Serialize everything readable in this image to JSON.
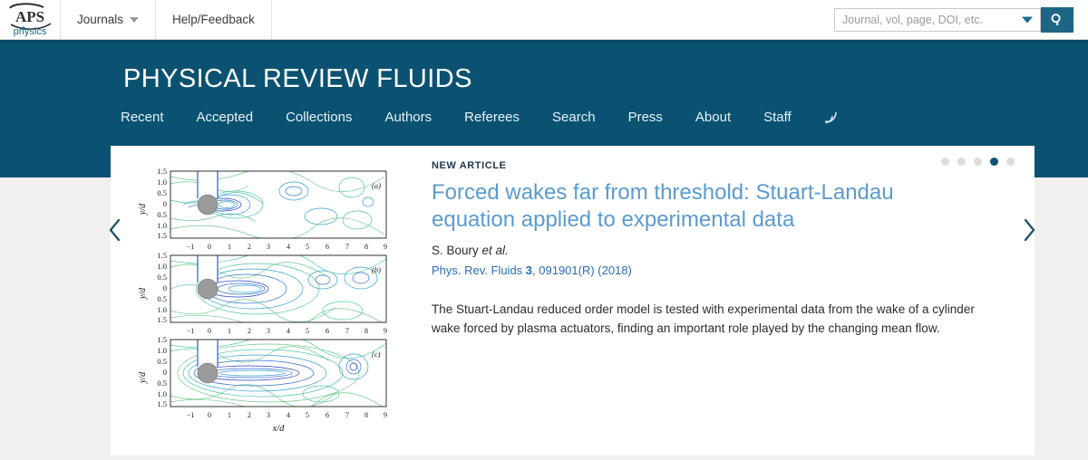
{
  "topbar": {
    "logo": {
      "primary": "APS",
      "secondary": "physics",
      "name": "aps-physics-logo"
    },
    "nav": [
      {
        "label": "Journals",
        "has_dropdown": true
      },
      {
        "label": "Help/Feedback",
        "has_dropdown": false
      }
    ],
    "search": {
      "placeholder": "Journal, vol, page, DOI, etc.",
      "value": "",
      "button_icon": "search-icon",
      "dropdown_icon": "chevron-down-icon"
    }
  },
  "banner": {
    "title": "PHYSICAL REVIEW FLUIDS",
    "background": "#0b5272",
    "nav": [
      "Recent",
      "Accepted",
      "Collections",
      "Authors",
      "Referees",
      "Search",
      "Press",
      "About",
      "Staff"
    ],
    "rss_icon": "rss-feed-icon"
  },
  "carousel": {
    "dots_total": 5,
    "active_index": 3,
    "prev_icon": "chevron-left-icon",
    "next_icon": "chevron-right-icon",
    "accent_color": "#0b5272"
  },
  "article": {
    "kicker": "NEW ARTICLE",
    "title": "Forced wakes far from threshold: Stuart-Landau equation applied to experimental data",
    "title_color": "#5a9bd0",
    "authors_name": "S. Boury ",
    "authors_etal": "et al.",
    "citation_journal": "Phys. Rev. Fluids ",
    "citation_volume": "3",
    "citation_rest": ", 091901(R) (2018)",
    "citation_color": "#2a6ebb",
    "teaser": "The Stuart-Landau reduced order model is tested with experimental data from the wake of a cylinder wake forced by plasma actuators, finding an important role played by the changing mean flow."
  },
  "chart_data": {
    "type": "contour",
    "title": "",
    "xlabel": "x/d",
    "ylabel": "y/d",
    "xlim": [
      -1.5,
      9
    ],
    "ylim": [
      -1.5,
      1.5
    ],
    "xticks": [
      -1,
      0,
      1,
      2,
      3,
      4,
      5,
      6,
      7,
      8,
      9
    ],
    "xticklabels": [
      "−1",
      "0",
      "1",
      "2",
      "3",
      "4",
      "5",
      "6",
      "7",
      "8",
      "9"
    ],
    "yticks": [
      1.5,
      1.0,
      0.5,
      0,
      -0.5,
      -1.0,
      -1.5
    ],
    "yticklabels": [
      "1.5",
      "1.0",
      "0.5",
      "0",
      "0.5",
      "1.0",
      "1.5"
    ],
    "grid": false,
    "legend": "none",
    "colors": [
      "#2b3fc4",
      "#2f6fd0",
      "#33a0cf",
      "#3fc0c0",
      "#55c79a",
      "#7fcf7a"
    ],
    "panels": [
      {
        "label": "(a)",
        "description": "Short compact wake directly behind cylinder, recirculation to x/d=2",
        "wake_length": 2.2,
        "cylinder": {
          "x": 0,
          "y": 0,
          "diameter": 1.0,
          "color": "#9a9a9a"
        }
      },
      {
        "label": "(b)",
        "description": "Intermediate elongated wake extending to x/d=4",
        "wake_length": 4.0,
        "cylinder": {
          "x": 0,
          "y": 0,
          "diameter": 1.0,
          "color": "#9a9a9a"
        }
      },
      {
        "label": "(c)",
        "description": "Long coherent wake extending to x/d=5.5",
        "wake_length": 5.5,
        "cylinder": {
          "x": 0,
          "y": 0,
          "diameter": 1.0,
          "color": "#9a9a9a"
        }
      }
    ]
  }
}
